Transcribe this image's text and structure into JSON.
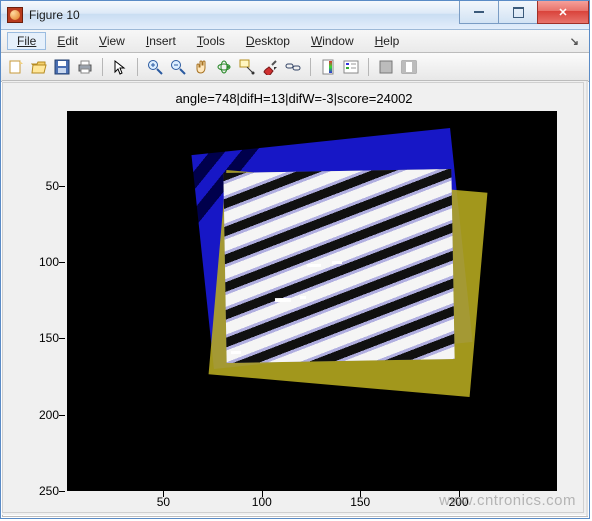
{
  "window": {
    "title": "Figure 10"
  },
  "menu": {
    "file": "File",
    "edit": "Edit",
    "view": "View",
    "insert": "Insert",
    "tools": "Tools",
    "desktop": "Desktop",
    "window": "Window",
    "help": "Help",
    "curl": "↘"
  },
  "toolbar_icons": {
    "new": "new-figure-icon",
    "open": "open-icon",
    "save": "save-icon",
    "print": "print-icon",
    "pointer": "pointer-icon",
    "zoomin": "zoom-in-icon",
    "zoomout": "zoom-out-icon",
    "pan": "pan-icon",
    "rotate": "rotate-3d-icon",
    "datacursor": "data-cursor-icon",
    "brush": "brush-icon",
    "link": "link-plot-icon",
    "colorbar": "colorbar-icon",
    "legend": "legend-icon",
    "hideplot": "hide-plot-tools-icon",
    "showplot": "show-plot-tools-icon"
  },
  "figure": {
    "title": "angle=748|difH=13|difW=-3|score=24002"
  },
  "chart_data": {
    "type": "heatmap",
    "title": "angle=748|difH=13|difW=-3|score=24002",
    "xlabel": "",
    "ylabel": "",
    "xlim": [
      1,
      250
    ],
    "ylim": [
      1,
      250
    ],
    "xticks": [
      50,
      100,
      150,
      200
    ],
    "yticks": [
      50,
      100,
      150,
      200,
      250
    ],
    "y_axis_reversed": true,
    "series": [
      {
        "name": "reference-image",
        "shape": "rect",
        "rotation_deg": -6,
        "approx_bounds_xy": {
          "x1": 75,
          "y1": 25,
          "x2": 200,
          "y2": 165
        },
        "fill": "blue-diagonal-stripes"
      },
      {
        "name": "moving-image",
        "shape": "rect",
        "rotation_deg": 5,
        "approx_bounds_xy": {
          "x1": 82,
          "y1": 52,
          "x2": 210,
          "y2": 185
        },
        "fill": "olive"
      },
      {
        "name": "overlap-fringes",
        "shape": "rect",
        "rotation_deg": -1,
        "approx_bounds_xy": {
          "x1": 85,
          "y1": 48,
          "x2": 197,
          "y2": 170
        },
        "fill": "grey-sinusoidal-stripes"
      }
    ],
    "registration_params": {
      "angle": 748,
      "difH": 13,
      "difW": -3,
      "score": 24002
    }
  },
  "ticks": {
    "y": [
      {
        "v": 50,
        "label": "50"
      },
      {
        "v": 100,
        "label": "100"
      },
      {
        "v": 150,
        "label": "150"
      },
      {
        "v": 200,
        "label": "200"
      },
      {
        "v": 250,
        "label": "250"
      }
    ],
    "x": [
      {
        "v": 50,
        "label": "50"
      },
      {
        "v": 100,
        "label": "100"
      },
      {
        "v": 150,
        "label": "150"
      },
      {
        "v": 200,
        "label": "200"
      }
    ]
  },
  "watermark": "www.cntronics.com"
}
